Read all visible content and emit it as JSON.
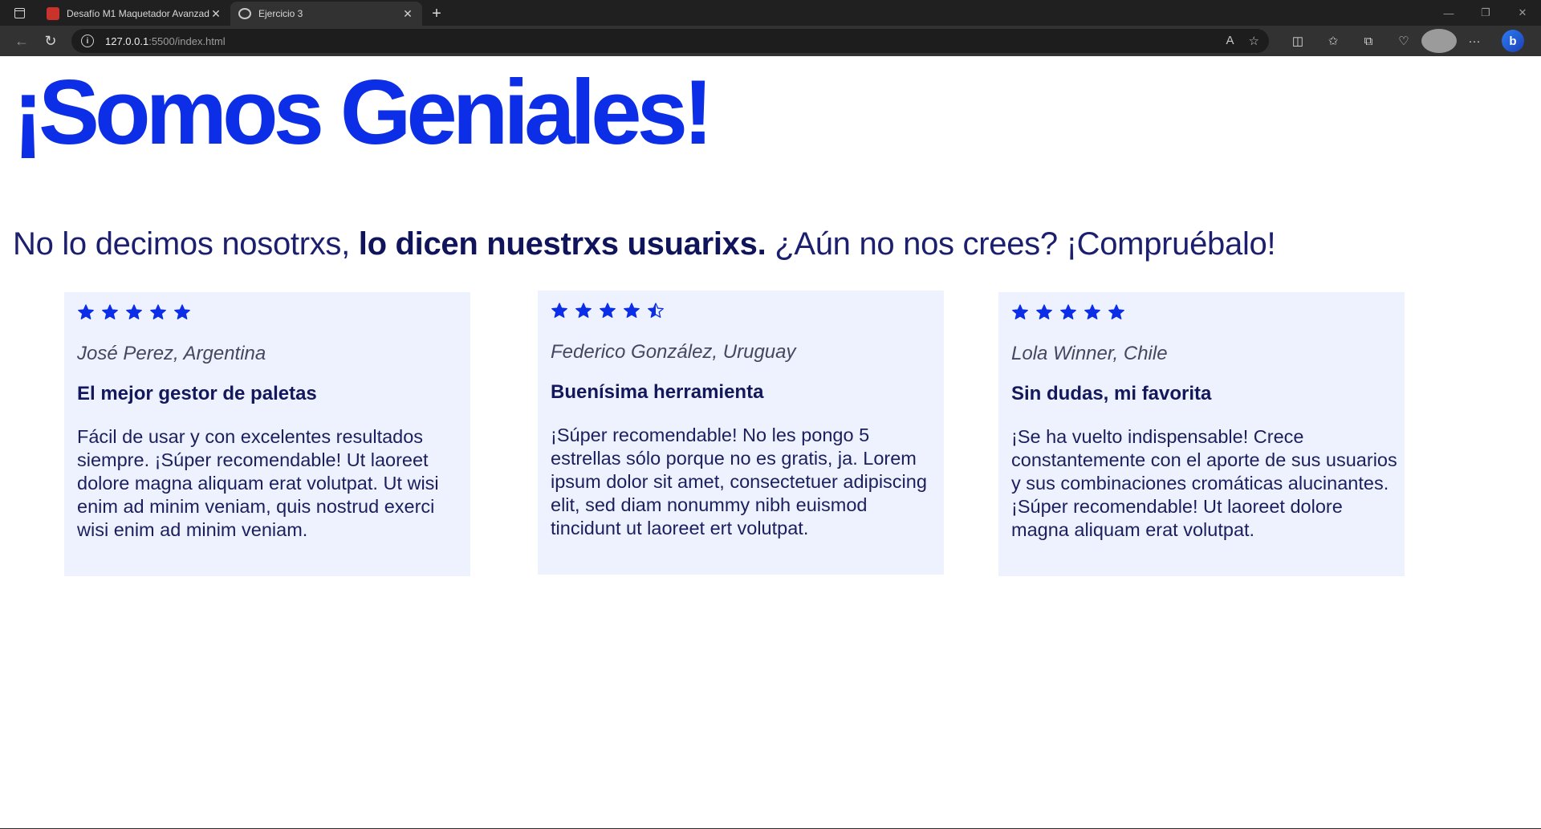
{
  "browser": {
    "tabs": [
      {
        "title": "Desafío M1 Maquetador Avanzado",
        "favicon": "pdf-icon",
        "active": false
      },
      {
        "title": "Ejercicio 3",
        "favicon": "broadcast-icon",
        "active": true
      }
    ],
    "new_tab_label": "+",
    "url_host": "127.0.0.1",
    "url_path": ":5500/index.html"
  },
  "page": {
    "title": "¡Somos Geniales!",
    "intro_start": "No lo decimos nosotrxs, ",
    "intro_bold": "lo dicen nuestrxs usuarixs.",
    "intro_end": " ¿Aún no nos crees? ¡Compruébalo!",
    "accent_color": "#0b2ee6",
    "card_background": "#eef2ff"
  },
  "reviews": [
    {
      "rating": 5,
      "author": "José Perez, Argentina",
      "heading": "El mejor gestor de paletas",
      "body": "Fácil de usar y con excelentes resultados siempre. ¡Súper recomendable! Ut laoreet dolore magna aliquam erat volutpat. Ut wisi enim ad minim veniam, quis nostrud exerci wisi enim ad minim veniam."
    },
    {
      "rating": 4.5,
      "author": "Federico González, Uruguay",
      "heading": "Buenísima herramienta",
      "body": "¡Súper recomendable! No les pongo 5 estrellas sólo porque no es gratis, ja. Lorem ipsum dolor sit amet, consectetuer adipiscing elit, sed diam nonummy nibh euismod tincidunt ut laoreet ert volutpat."
    },
    {
      "rating": 5,
      "author": "Lola Winner, Chile",
      "heading": "Sin dudas, mi favorita",
      "body": "¡Se ha vuelto indispensable! Crece constantemente con el aporte de sus usuarios y sus combinaciones cromáticas alucinantes. ¡Súper recomendable! Ut laoreet dolore magna aliquam erat volutpat."
    }
  ]
}
